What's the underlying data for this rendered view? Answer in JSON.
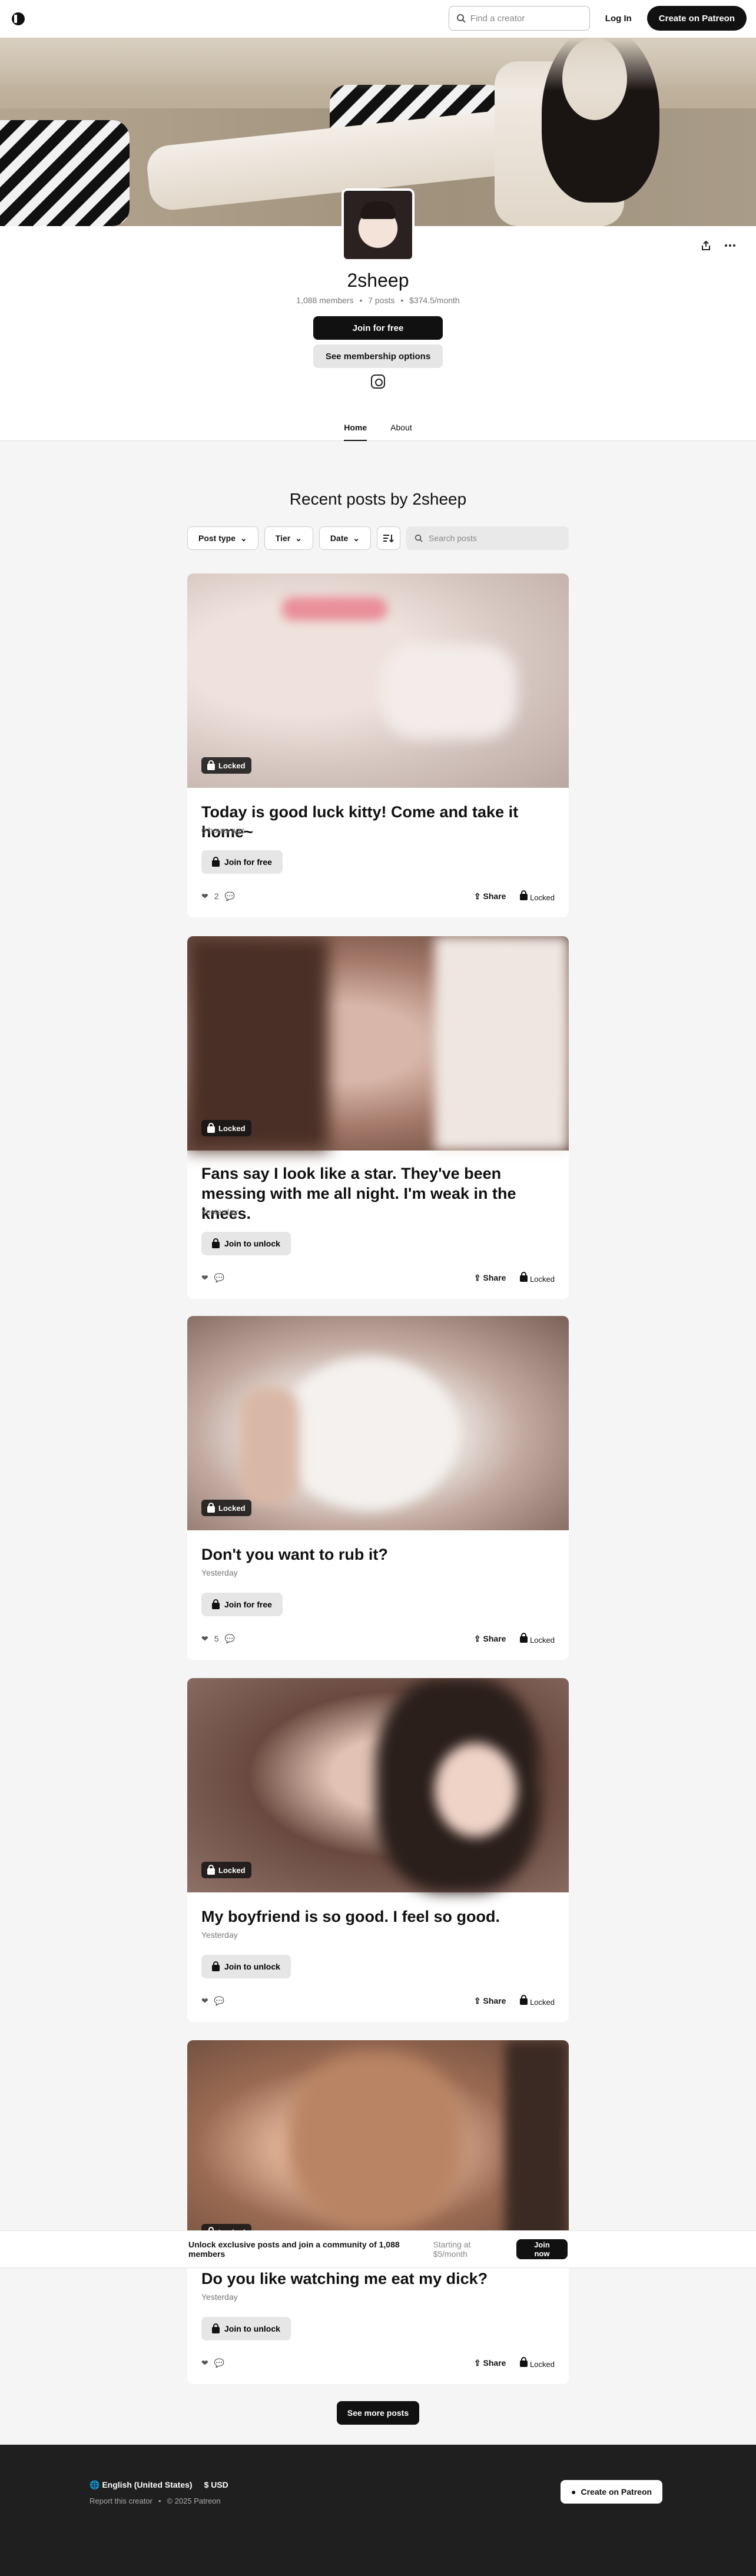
{
  "header": {
    "search_placeholder": "Find a creator",
    "login": "Log In",
    "create": "Create on Patreon"
  },
  "profile": {
    "name": "2sheep",
    "members": "1,088 members",
    "posts": "7 posts",
    "income": "$374.5/month",
    "join_label": "Join for free",
    "options_label": "See membership options"
  },
  "tabs": [
    "Home",
    "About"
  ],
  "feed": {
    "title": "Recent posts by 2sheep",
    "filters": [
      "Post type",
      "Tier",
      "Date"
    ],
    "search_placeholder": "Search posts"
  },
  "posts": [
    {
      "title": "Today is good luck kitty! Come and take it home~",
      "date": "6 hours ago",
      "cta": "Join for free",
      "likes": "2",
      "badge": "Locked",
      "share": "Share",
      "lock": "Locked"
    },
    {
      "title": "Fans say I look like a star. They've been messing with me all night. I'm weak in the knees.",
      "date": "Yesterday",
      "cta": "Join to unlock",
      "likes": "",
      "badge": "Locked",
      "share": "Share",
      "lock": "Locked"
    },
    {
      "title": "Don't you want to rub it?",
      "date": "Yesterday",
      "cta": "Join for free",
      "likes": "5",
      "badge": "Locked",
      "share": "Share",
      "lock": "Locked"
    },
    {
      "title": "My boyfriend is so good. I feel so good.",
      "date": "Yesterday",
      "cta": "Join to unlock",
      "likes": "",
      "badge": "Locked",
      "share": "Share",
      "lock": "Locked"
    },
    {
      "title": "Do you like watching me eat my dick?",
      "date": "Yesterday",
      "cta": "Join to unlock",
      "likes": "",
      "badge": "Locked",
      "share": "Share",
      "lock": "Locked"
    }
  ],
  "sticky": {
    "message": "Unlock exclusive posts and join a community of 1,088 members",
    "price": "Starting at $5/month",
    "join": "Join now"
  },
  "more_label": "See more posts",
  "footer": {
    "language": "English (United States)",
    "currency": "$ USD",
    "report": "Report this creator",
    "copyright": "© 2025 Patreon",
    "create": "Create on Patreon"
  }
}
